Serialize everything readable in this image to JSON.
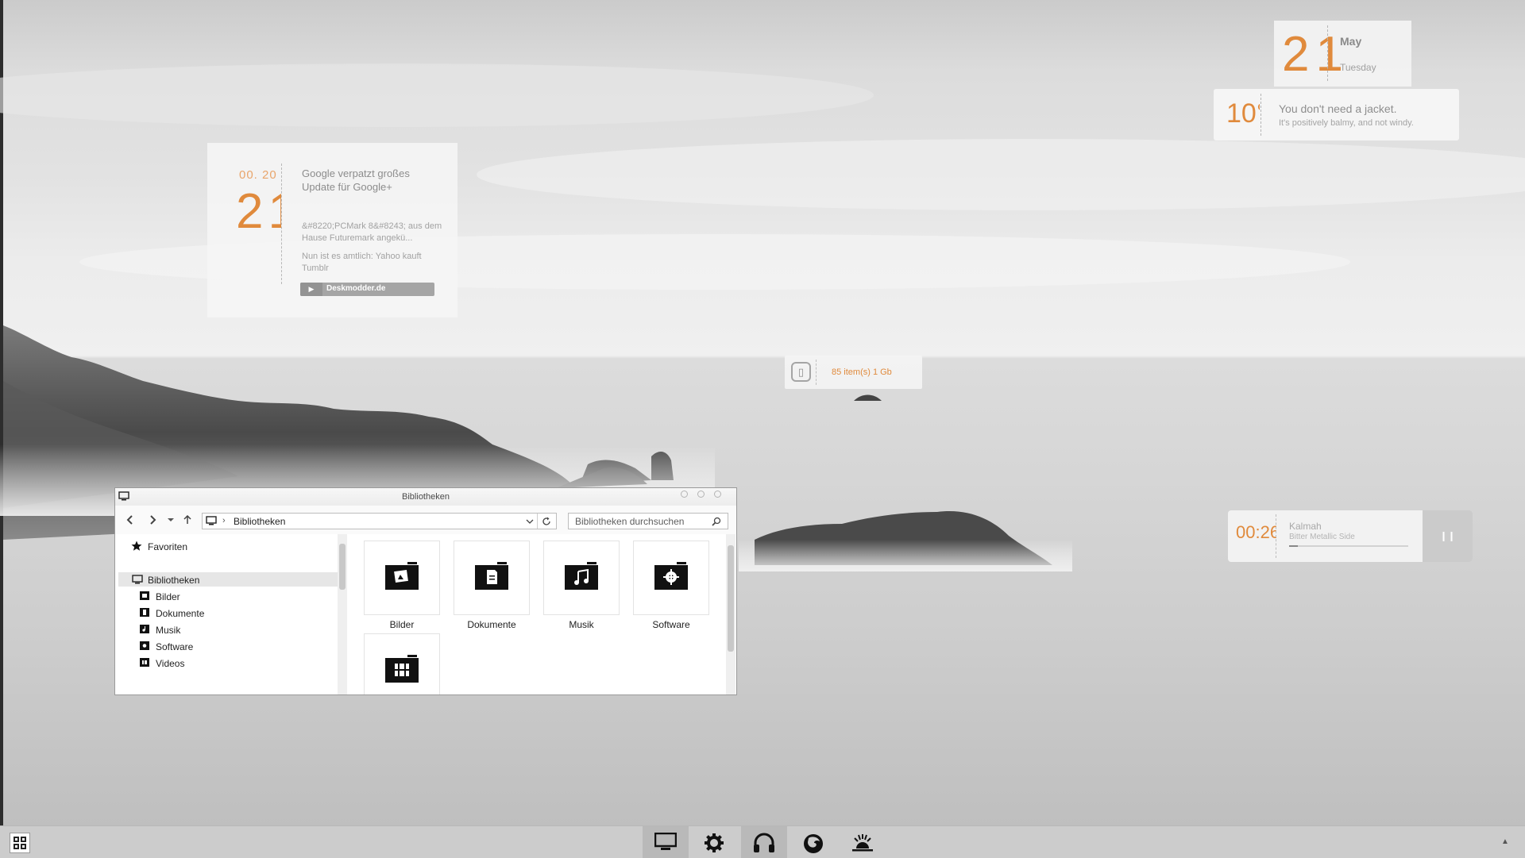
{
  "calendar": {
    "day": "21",
    "month": "May",
    "weekday": "Tuesday"
  },
  "weather": {
    "temperature": "10°",
    "title": "You don't need a jacket.",
    "description": "It's positively balmy, and not windy."
  },
  "news": {
    "date": "00. 20",
    "day": "21",
    "headline": "Google verpatzt großes Update für Google+",
    "items": [
      "&#8220;PCMark 8&#8243; aus dem Hause Futuremark angekü...",
      "Nun ist es amtlich: Yahoo kauft Tumblr"
    ],
    "source": "Deskmodder.de"
  },
  "recycle_bin": {
    "text": "85 item(s)   1 Gb"
  },
  "music": {
    "time": "00:26",
    "artist": "Kalmah",
    "track": "Bitter Metallic Side",
    "progress": 0.07
  },
  "explorer": {
    "title": "Bibliotheken",
    "address": "Bibliotheken",
    "search_placeholder": "Bibliotheken durchsuchen",
    "sidebar": {
      "favorites": "Favoriten",
      "libraries": "Bibliotheken",
      "items": [
        "Bilder",
        "Dokumente",
        "Musik",
        "Software",
        "Videos"
      ]
    },
    "tiles": [
      "Bilder",
      "Dokumente",
      "Musik",
      "Software"
    ]
  },
  "taskbar": {
    "icons": [
      "monitor-icon",
      "gear-icon",
      "headphones-icon",
      "firefox-icon",
      "sunrise-icon"
    ]
  },
  "colors": {
    "accent": "#e08a3c",
    "tray": "#cccccc"
  }
}
